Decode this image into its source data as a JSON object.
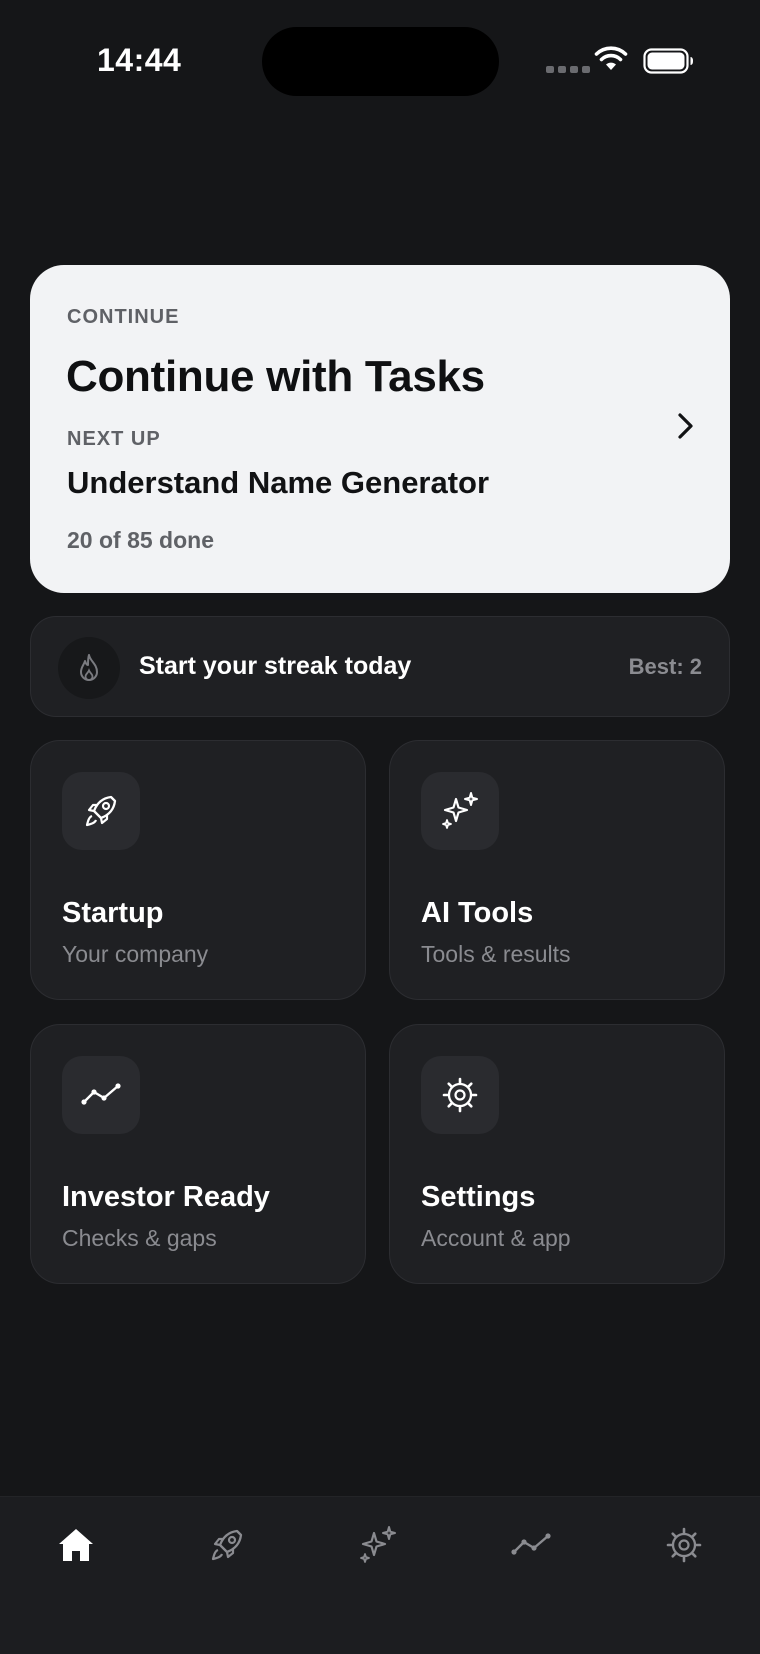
{
  "status_bar": {
    "time": "14:44"
  },
  "continue_card": {
    "eyebrow": "CONTINUE",
    "title": "Continue with Tasks",
    "next_up_label": "NEXT UP",
    "next_task": "Understand Name Generator",
    "progress_text": "20 of 85 done",
    "progress": {
      "done": 20,
      "total": 85
    }
  },
  "streak": {
    "text": "Start your streak today",
    "best_label": "Best: 2"
  },
  "tiles": [
    {
      "title": "Startup",
      "subtitle": "Your company",
      "icon": "rocket-icon"
    },
    {
      "title": "AI Tools",
      "subtitle": "Tools & results",
      "icon": "sparkles-icon"
    },
    {
      "title": "Investor Ready",
      "subtitle": "Checks & gaps",
      "icon": "trend-line-icon"
    },
    {
      "title": "Settings",
      "subtitle": "Account & app",
      "icon": "gear-icon"
    }
  ],
  "tab_bar": {
    "items": [
      {
        "icon": "home-icon",
        "active": true
      },
      {
        "icon": "rocket-icon",
        "active": false
      },
      {
        "icon": "sparkles-icon",
        "active": false
      },
      {
        "icon": "trend-line-icon",
        "active": false
      },
      {
        "icon": "gear-icon",
        "active": false
      }
    ]
  },
  "colors": {
    "background": "#151618",
    "card_light": "#f2f3f5",
    "tile_bg": "#1f2023",
    "text_primary": "#ffffff",
    "text_secondary": "#8a8b90",
    "tab_active": "#ffffff",
    "tab_inactive": "#8a8b90"
  }
}
